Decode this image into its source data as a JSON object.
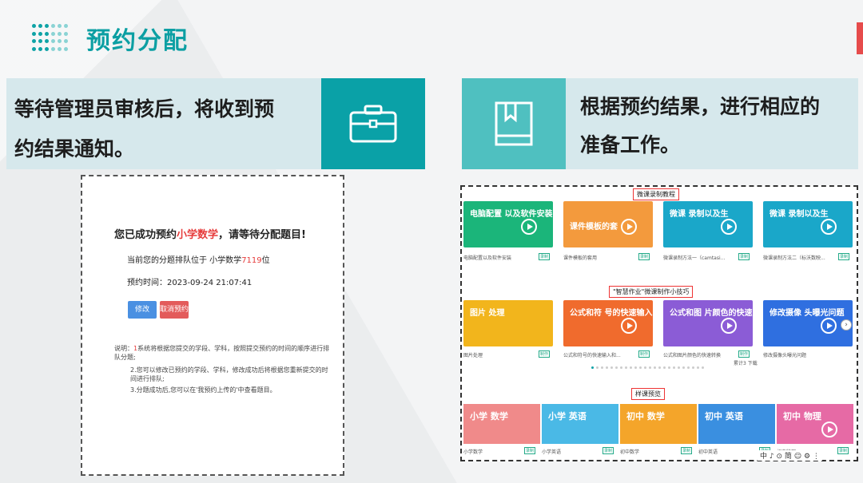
{
  "header": {
    "title": "预约分配"
  },
  "left_card": {
    "line1": "等待管理员审核后，将收到预",
    "line2": "约结果通知。"
  },
  "right_card": {
    "line1": "根据预约结果，进行相应的",
    "line2": "准备工作。"
  },
  "booking": {
    "title_pre": "您已成功预约",
    "title_subject": "小学数学",
    "title_post": "，请等待分配题目!",
    "queue_pre": "当前您的分题排队位于 小学数学",
    "queue_num": "7119",
    "queue_post": "位",
    "time_label": "预约时间：2023-09-24 21:07:41",
    "edit_label": "修改",
    "cancel_label": "取消预约",
    "note_pre": "说明：",
    "note1_num": "1",
    "note1": "系统将根据您提交的学段、学科，按照提交预约的时间的顺序进行排队分题;",
    "note2": "2.您可以修改已预约的学段、学科，修改成功后将根据您重新提交的时间进行排队;",
    "note3": "3.分题成功后,您可以在'我预约上传的'中查看题目。"
  },
  "portal": {
    "section1": "微课录制教程",
    "section2": "\"智慧作业\"微课制作小技巧",
    "section3": "样课预览",
    "row1": [
      {
        "text": "电脑配置 以及软件安装",
        "caption": "电脑配置以及软件安装",
        "tag": "录制",
        "color": "#1bb57a"
      },
      {
        "text": "课件模板的套",
        "caption": "课件模板的套用",
        "tag": "录制",
        "color": "#f39a3d"
      },
      {
        "text": "微课 录制以及生",
        "caption": "微课录制方法一（camtasi...",
        "tag": "录制",
        "color": "#1aa7c9"
      },
      {
        "text": "微课 录制以及生",
        "caption": "微课录制方法二（标沃数映...",
        "tag": "录制",
        "color": "#1aa7c9"
      }
    ],
    "row2": [
      {
        "text": "图片 处理",
        "caption": "图片处理",
        "tag": "制作",
        "color": "#f2b51c"
      },
      {
        "text": "公式和符 号的快速输入",
        "caption": "公式和符号的快速输入和...",
        "tag": "制作",
        "color": "#f06b2d"
      },
      {
        "text": "公式和图 片颜色的快速",
        "caption": "公式和图片颜色的快速转换",
        "tag": "制作",
        "color": "#8b5cd6"
      },
      {
        "text": "修改摄像 头曝光问题",
        "caption": "修改摄像头曝光问题",
        "tag": "制作",
        "color": "#2f6fe0"
      }
    ],
    "row2_count": "累计3 下载",
    "row3": [
      {
        "text": "小学 数学",
        "caption": "小学数学",
        "tag": "录制",
        "color": "#f08a8a"
      },
      {
        "text": "小学 英语",
        "caption": "小学英语",
        "tag": "录制",
        "color": "#4ab9e6"
      },
      {
        "text": "初中 数学",
        "caption": "初中数学",
        "tag": "录制",
        "color": "#f4a52a"
      },
      {
        "text": "初中 英语",
        "caption": "初中英语",
        "tag": "录制",
        "color": "#3a8fe0"
      },
      {
        "text": "初中 物理",
        "caption": "初中物理",
        "tag": "录制",
        "color": "#e66aa5"
      }
    ],
    "toolbar": "中 ♪ ⊙ 简 ☺ ⚙ ⋮"
  }
}
